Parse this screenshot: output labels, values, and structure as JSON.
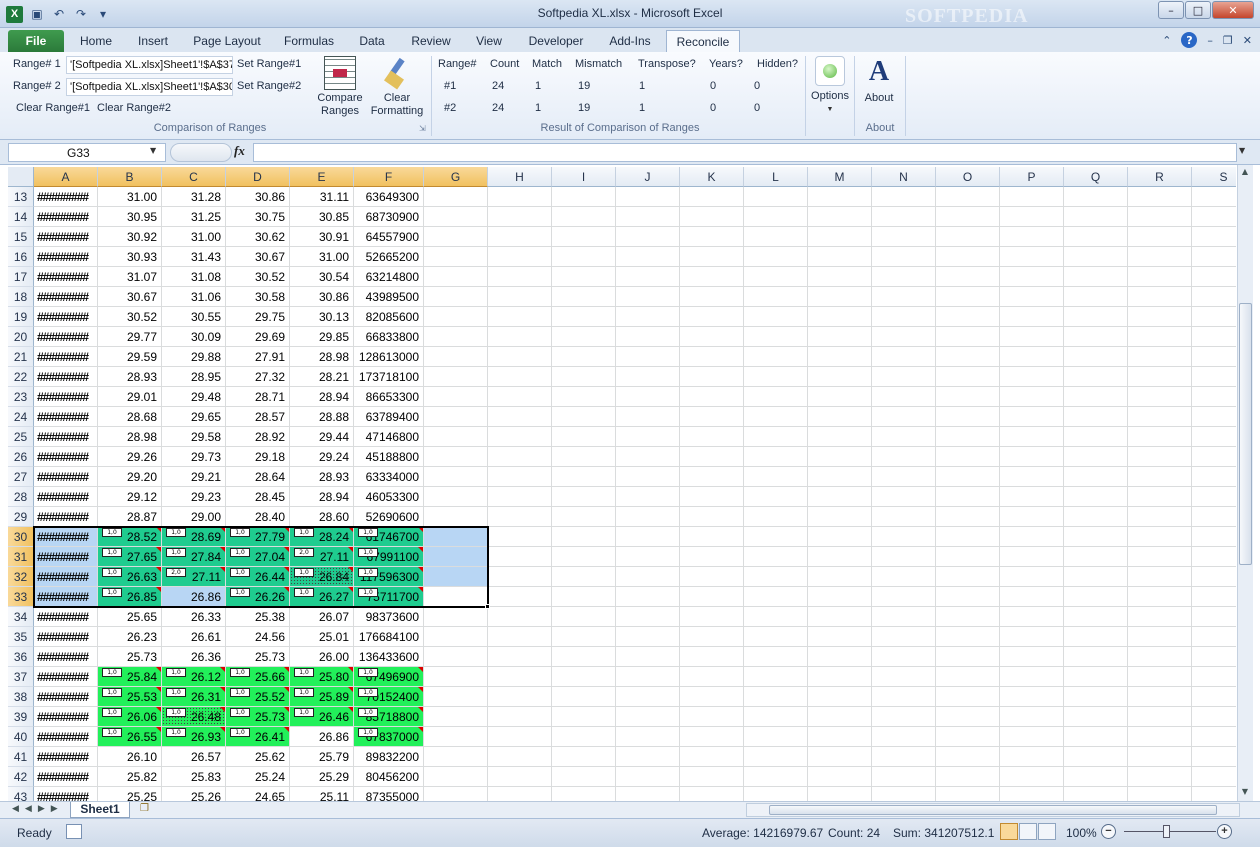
{
  "window": {
    "title": "Softpedia XL.xlsx - Microsoft Excel",
    "watermark": "SOFTPEDIA"
  },
  "tabs": [
    "File",
    "Home",
    "Insert",
    "Page Layout",
    "Formulas",
    "Data",
    "Review",
    "View",
    "Developer",
    "Add-Ins",
    "Reconcile"
  ],
  "ribbon": {
    "range1_label": "Range# 1",
    "range1_value": "'[Softpedia XL.xlsx]Sheet1'!$A$37",
    "set_range1": "Set Range#1",
    "range2_label": "Range# 2",
    "range2_value": "'[Softpedia XL.xlsx]Sheet1'!$A$30",
    "set_range2": "Set Range#2",
    "clear_range1": "Clear Range#1",
    "clear_range2": "Clear Range#2",
    "compare_line1": "Compare",
    "compare_line2": "Ranges",
    "clear_line1": "Clear",
    "clear_line2": "Formatting",
    "group1_label": "Comparison of Ranges",
    "results": {
      "headers": [
        "Range#",
        "Count",
        "Match",
        "Mismatch",
        "Transpose?",
        "Years?",
        "Hidden?"
      ],
      "rows": [
        [
          "#1",
          "24",
          "1",
          "19",
          "1",
          "0",
          "0"
        ],
        [
          "#2",
          "24",
          "1",
          "19",
          "1",
          "0",
          "0"
        ]
      ]
    },
    "group2_label": "Result of Comparison of Ranges",
    "options_label": "Options",
    "about_label": "About",
    "group3_label": "About"
  },
  "formula_bar": {
    "name_box": "G33",
    "fx": "fx",
    "formula": ""
  },
  "columns": [
    "A",
    "B",
    "C",
    "D",
    "E",
    "F",
    "G",
    "H",
    "I",
    "J",
    "K",
    "L",
    "M",
    "N",
    "O",
    "P",
    "Q",
    "R",
    "S"
  ],
  "rows": [
    {
      "n": "13",
      "a": "#########",
      "v": [
        "31.00",
        "31.28",
        "30.86",
        "31.11",
        "63649300"
      ]
    },
    {
      "n": "14",
      "a": "#########",
      "v": [
        "30.95",
        "31.25",
        "30.75",
        "30.85",
        "68730900"
      ]
    },
    {
      "n": "15",
      "a": "#########",
      "v": [
        "30.92",
        "31.00",
        "30.62",
        "30.91",
        "64557900"
      ]
    },
    {
      "n": "16",
      "a": "#########",
      "v": [
        "30.93",
        "31.43",
        "30.67",
        "31.00",
        "52665200"
      ]
    },
    {
      "n": "17",
      "a": "#########",
      "v": [
        "31.07",
        "31.08",
        "30.52",
        "30.54",
        "63214800"
      ]
    },
    {
      "n": "18",
      "a": "#########",
      "v": [
        "30.67",
        "31.06",
        "30.58",
        "30.86",
        "43989500"
      ]
    },
    {
      "n": "19",
      "a": "#########",
      "v": [
        "30.52",
        "30.55",
        "29.75",
        "30.13",
        "82085600"
      ]
    },
    {
      "n": "20",
      "a": "#########",
      "v": [
        "29.77",
        "30.09",
        "29.69",
        "29.85",
        "66833800"
      ]
    },
    {
      "n": "21",
      "a": "#########",
      "v": [
        "29.59",
        "29.88",
        "27.91",
        "28.98",
        "128613000"
      ]
    },
    {
      "n": "22",
      "a": "#########",
      "v": [
        "28.93",
        "28.95",
        "27.32",
        "28.21",
        "173718100"
      ]
    },
    {
      "n": "23",
      "a": "#########",
      "v": [
        "29.01",
        "29.48",
        "28.71",
        "28.94",
        "86653300"
      ]
    },
    {
      "n": "24",
      "a": "#########",
      "v": [
        "28.68",
        "29.65",
        "28.57",
        "28.88",
        "63789400"
      ]
    },
    {
      "n": "25",
      "a": "#########",
      "v": [
        "28.98",
        "29.58",
        "28.92",
        "29.44",
        "47146800"
      ]
    },
    {
      "n": "26",
      "a": "#########",
      "v": [
        "29.26",
        "29.73",
        "29.18",
        "29.24",
        "45188800"
      ]
    },
    {
      "n": "27",
      "a": "#########",
      "v": [
        "29.20",
        "29.21",
        "28.64",
        "28.93",
        "63334000"
      ]
    },
    {
      "n": "28",
      "a": "#########",
      "v": [
        "29.12",
        "29.23",
        "28.45",
        "28.94",
        "46053300"
      ]
    },
    {
      "n": "29",
      "a": "#########",
      "v": [
        "28.87",
        "29.00",
        "28.40",
        "28.60",
        "52690600"
      ]
    },
    {
      "n": "30",
      "a": "#########",
      "v": [
        "28.52",
        "28.69",
        "27.79",
        "28.24",
        "61746700"
      ],
      "b": [
        "1,0",
        "1,0",
        "1,0",
        "1,0",
        "1,0"
      ]
    },
    {
      "n": "31",
      "a": "#########",
      "v": [
        "27.65",
        "27.84",
        "27.04",
        "27.11",
        "67991100"
      ],
      "b": [
        "1,0",
        "1,0",
        "1,0",
        "2,0",
        "1,0"
      ]
    },
    {
      "n": "32",
      "a": "#########",
      "v": [
        "26.63",
        "27.11",
        "26.44",
        "26.84",
        "117596300"
      ],
      "b": [
        "1,0",
        "2,0",
        "1,0",
        "1,0",
        "1,0"
      ]
    },
    {
      "n": "33",
      "a": "#########",
      "v": [
        "26.85",
        "26.86",
        "26.26",
        "26.27",
        "75711700"
      ],
      "b": [
        "1,0",
        "",
        "1,0",
        "1,0",
        "1,0"
      ]
    },
    {
      "n": "34",
      "a": "#########",
      "v": [
        "25.65",
        "26.33",
        "25.38",
        "26.07",
        "98373600"
      ]
    },
    {
      "n": "35",
      "a": "#########",
      "v": [
        "26.23",
        "26.61",
        "24.56",
        "25.01",
        "176684100"
      ]
    },
    {
      "n": "36",
      "a": "#########",
      "v": [
        "25.73",
        "26.36",
        "25.73",
        "26.00",
        "136433600"
      ]
    },
    {
      "n": "37",
      "a": "#########",
      "v": [
        "25.84",
        "26.12",
        "25.66",
        "25.80",
        "67496900"
      ],
      "b": [
        "1,0",
        "1,0",
        "1,0",
        "1,0",
        "1,0"
      ]
    },
    {
      "n": "38",
      "a": "#########",
      "v": [
        "25.53",
        "26.31",
        "25.52",
        "25.89",
        "70152400"
      ],
      "b": [
        "1,0",
        "1,0",
        "1,0",
        "1,0",
        "1,0"
      ]
    },
    {
      "n": "39",
      "a": "#########",
      "v": [
        "26.06",
        "26.48",
        "25.73",
        "26.46",
        "85718800"
      ],
      "b": [
        "1,0",
        "1,0",
        "1,0",
        "1,0",
        "1,0"
      ]
    },
    {
      "n": "40",
      "a": "#########",
      "v": [
        "26.55",
        "26.93",
        "26.41",
        "26.86",
        "67837000"
      ],
      "b": [
        "1,0",
        "1,0",
        "1,0",
        "",
        "1,0"
      ]
    },
    {
      "n": "41",
      "a": "#########",
      "v": [
        "26.10",
        "26.57",
        "25.62",
        "25.79",
        "89832200"
      ]
    },
    {
      "n": "42",
      "a": "#########",
      "v": [
        "25.82",
        "25.83",
        "25.24",
        "25.29",
        "80456200"
      ]
    },
    {
      "n": "43",
      "a": "#########",
      "v": [
        "25.25",
        "25.26",
        "24.65",
        "25.11",
        "87355000"
      ]
    }
  ],
  "colors": {
    "mismatch_range2": "#1fcc8f",
    "mismatch_range1": "#22f05a",
    "selection": "#b8d6f4"
  },
  "sheet_tab": "Sheet1",
  "status": {
    "ready": "Ready",
    "average": "Average: 14216979.67",
    "count": "Count: 24",
    "sum": "Sum: 341207512.1",
    "zoom": "100%"
  }
}
